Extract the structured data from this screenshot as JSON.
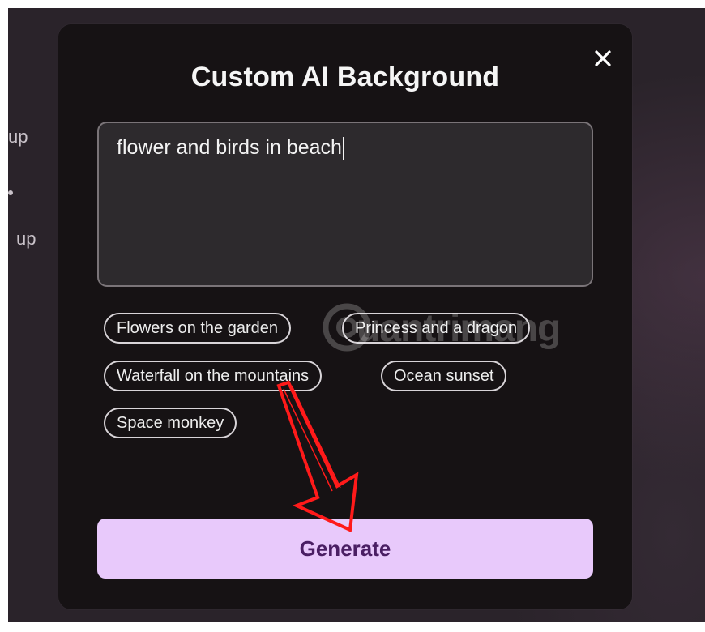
{
  "background": {
    "texts": [
      "up",
      "",
      "up"
    ]
  },
  "dialog": {
    "title": "Custom AI Background",
    "close_icon": "close-icon",
    "prompt_value": "flower and birds in beach",
    "suggestions": [
      "Flowers on the garden",
      "Princess and a dragon",
      "Waterfall on the mountains",
      "Ocean sunset",
      "Space monkey"
    ],
    "generate_label": "Generate"
  },
  "watermark": {
    "text": "uantrimang",
    "logo_icon": "at-sign-logo-icon"
  },
  "colors": {
    "dialog_background": "#161214",
    "input_background": "#2d2a2d",
    "generate_button": "#e8c9fb",
    "generate_text": "#4a1e63",
    "annotation_arrow": "#ff1a1a"
  }
}
